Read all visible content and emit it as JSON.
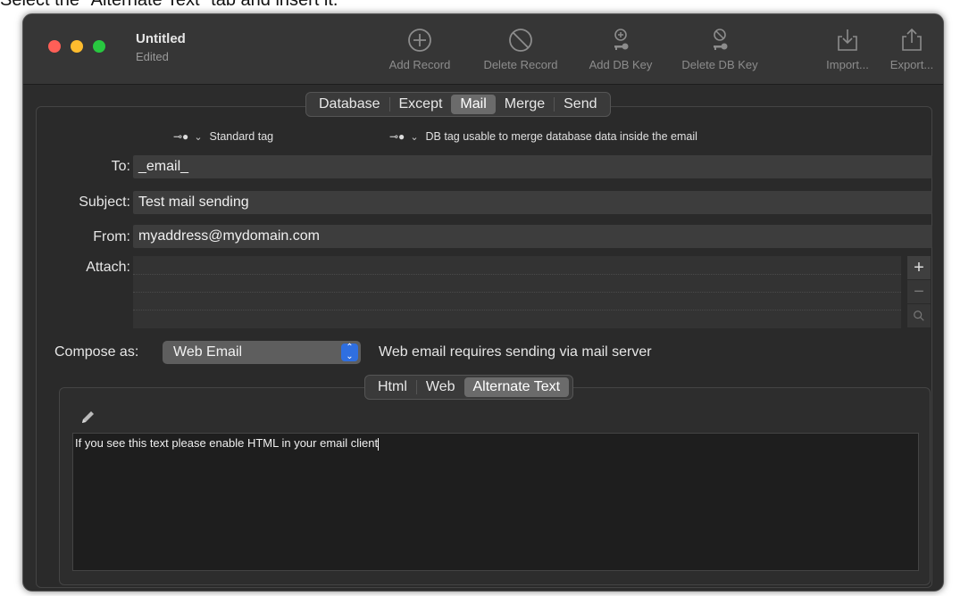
{
  "instruction": "Select the \"Alternate Text\" tab and insert it.",
  "window": {
    "title": "Untitled",
    "subtitle": "Edited"
  },
  "toolbar": {
    "add_record": "Add Record",
    "delete_record": "Delete Record",
    "add_db_key": "Add DB Key",
    "delete_db_key": "Delete DB Key",
    "import": "Import...",
    "export": "Export..."
  },
  "main_tabs": [
    {
      "label": "Database",
      "selected": false
    },
    {
      "label": "Except",
      "selected": false
    },
    {
      "label": "Mail",
      "selected": true
    },
    {
      "label": "Merge",
      "selected": false
    },
    {
      "label": "Send",
      "selected": false
    }
  ],
  "tags": {
    "standard": "Standard tag",
    "db": "DB tag usable to merge database data inside the email"
  },
  "form": {
    "to_label": "To:",
    "to_value": "_email_",
    "subject_label": "Subject:",
    "subject_value": "Test mail sending",
    "from_label": "From:",
    "from_value": "myaddress@mydomain.com",
    "attach_label": "Attach:"
  },
  "compose": {
    "label": "Compose as:",
    "value": "Web Email",
    "note": "Web email requires sending via mail server"
  },
  "body_tabs": [
    {
      "label": "Html",
      "selected": false
    },
    {
      "label": "Web",
      "selected": false
    },
    {
      "label": "Alternate Text",
      "selected": true
    }
  ],
  "editor": {
    "text": "If you see this text please enable HTML in your email client"
  },
  "colors": {
    "close": "#ff5f57",
    "minimize": "#febc2e",
    "maximize": "#28c840",
    "accent": "#2f6fe0"
  }
}
